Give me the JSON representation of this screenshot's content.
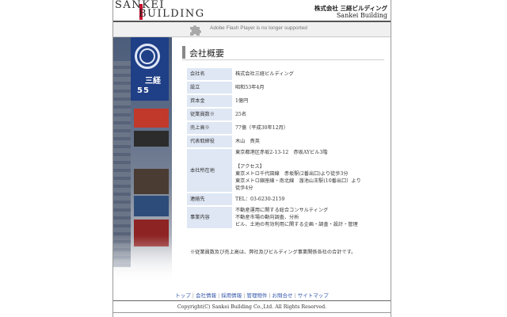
{
  "header": {
    "logo_line1": "SANKEI",
    "logo_line2": "BUILDING",
    "corp_name_jp": "株式会社 三経ビルディング",
    "corp_name_en": "Sankei Building"
  },
  "flash_notice": {
    "text": "Adobe Flash Player is no longer supported",
    "icon": "puzzle-piece-icon"
  },
  "hero": {
    "sign_kanji": "三経",
    "sign_number": "55"
  },
  "page": {
    "title": "会社概要"
  },
  "company_info": [
    {
      "label": "会社名",
      "value": [
        "株式会社三経ビルディング"
      ]
    },
    {
      "label": "設立",
      "value": [
        "昭和53年4月"
      ]
    },
    {
      "label": "資本金",
      "value": [
        "1億円"
      ]
    },
    {
      "label": "従業員数※",
      "value": [
        "25名"
      ]
    },
    {
      "label": "売上高※",
      "value": [
        "77億（平成30年12月）"
      ]
    },
    {
      "label": "代表取締役",
      "value": [
        "木山　貴英"
      ]
    },
    {
      "label": "本社所在地",
      "value": [
        "東京都港区赤坂2-13-12　赤坂AYビル3階",
        "",
        "【アクセス】",
        "東京メトロ千代田線　赤坂駅(2番出口)より徒歩3分",
        "東京メトロ銀座線・南北線　溜池山王駅(10番出口）より",
        "徒歩4分"
      ]
    },
    {
      "label": "連絡先",
      "value": [
        "TEL：03-6230-2159"
      ]
    },
    {
      "label": "事業内容",
      "value": [
        "不動産運用に関する総合コンサルティング",
        "不動産市場の動向調査、分析",
        "ビル、土地の有効利用に関する企画・調査・設計・管理"
      ]
    }
  ],
  "note": "※従業員数及び売上高は、弊社及びビルディング事業関係各社の合計です。",
  "footer": {
    "nav": [
      "トップ",
      "会社情報",
      "採用情報",
      "管理物件",
      "お問合せ",
      "サイトマップ"
    ],
    "separator": "|",
    "copyright": "Copyright(C) Sankei Building Co.,Ltd. All Rights Reserved."
  }
}
